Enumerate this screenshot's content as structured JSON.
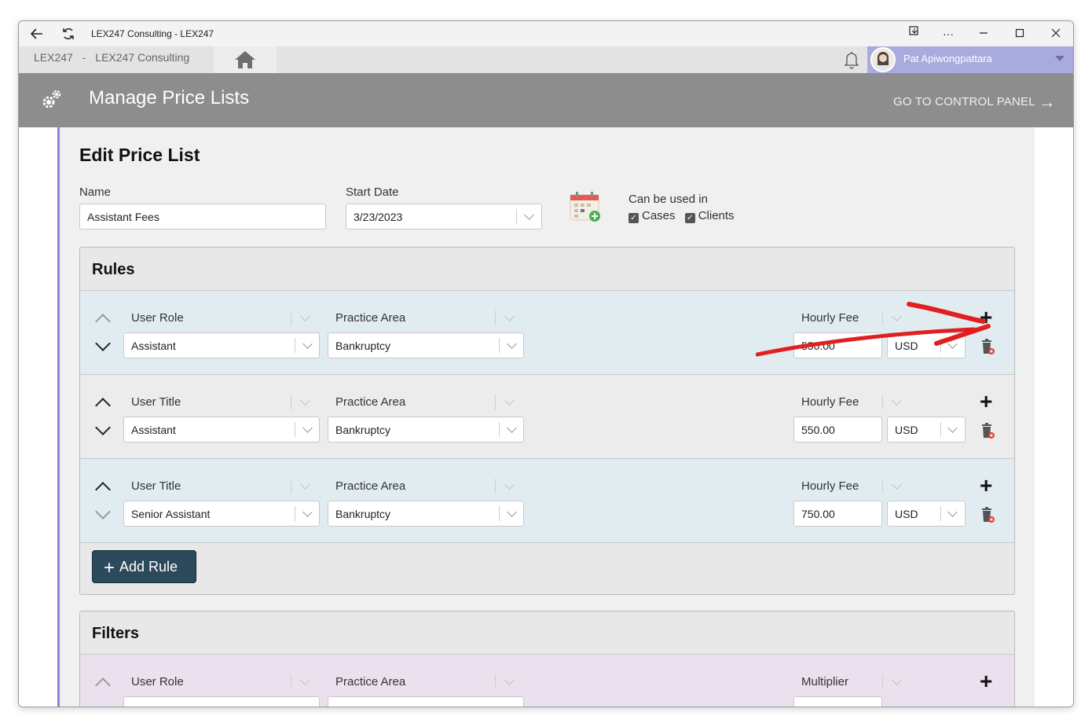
{
  "window": {
    "title": "LEX247 Consulting - LEX247",
    "controls": [
      "restore-icon",
      "more-icon",
      "minimize-icon",
      "maximize-icon",
      "close-icon"
    ]
  },
  "appbar": {
    "breadcrumb_root": "LEX247",
    "breadcrumb_sep": "-",
    "breadcrumb_current": "LEX247 Consulting",
    "user_name": "Pat Apiwongpattara"
  },
  "header": {
    "title": "Manage Price Lists",
    "go_to_control_panel": "GO TO CONTROL PANEL"
  },
  "edit": {
    "heading": "Edit Price List",
    "name_label": "Name",
    "name_value": "Assistant Fees",
    "start_date_label": "Start Date",
    "start_date_value": "3/23/2023",
    "can_be_used_label": "Can be used in",
    "checkbox_cases": "Cases",
    "checkbox_clients": "Clients"
  },
  "rules": {
    "title": "Rules",
    "rows": [
      {
        "field_a_label": "User Role",
        "field_a_value": "Assistant",
        "field_b_label": "Practice Area",
        "field_b_value": "Bankruptcy",
        "fee_label": "Hourly Fee",
        "fee_value": "550.00",
        "currency": "USD"
      },
      {
        "field_a_label": "User Title",
        "field_a_value": "Assistant",
        "field_b_label": "Practice Area",
        "field_b_value": "Bankruptcy",
        "fee_label": "Hourly Fee",
        "fee_value": "550.00",
        "currency": "USD"
      },
      {
        "field_a_label": "User Title",
        "field_a_value": "Senior Assistant",
        "field_b_label": "Practice Area",
        "field_b_value": "Bankruptcy",
        "fee_label": "Hourly Fee",
        "fee_value": "750.00",
        "currency": "USD"
      }
    ],
    "add_rule_label": "Add Rule"
  },
  "filters": {
    "title": "Filters",
    "rows": [
      {
        "field_a_label": "User Role",
        "field_b_label": "Practice Area",
        "fee_label": "Multiplier"
      }
    ]
  },
  "colors": {
    "accent_purple": "#8a85d6",
    "header_gray": "#8d8d8d",
    "button_dark": "#2b4a5b",
    "annotation_red": "#e02020"
  }
}
